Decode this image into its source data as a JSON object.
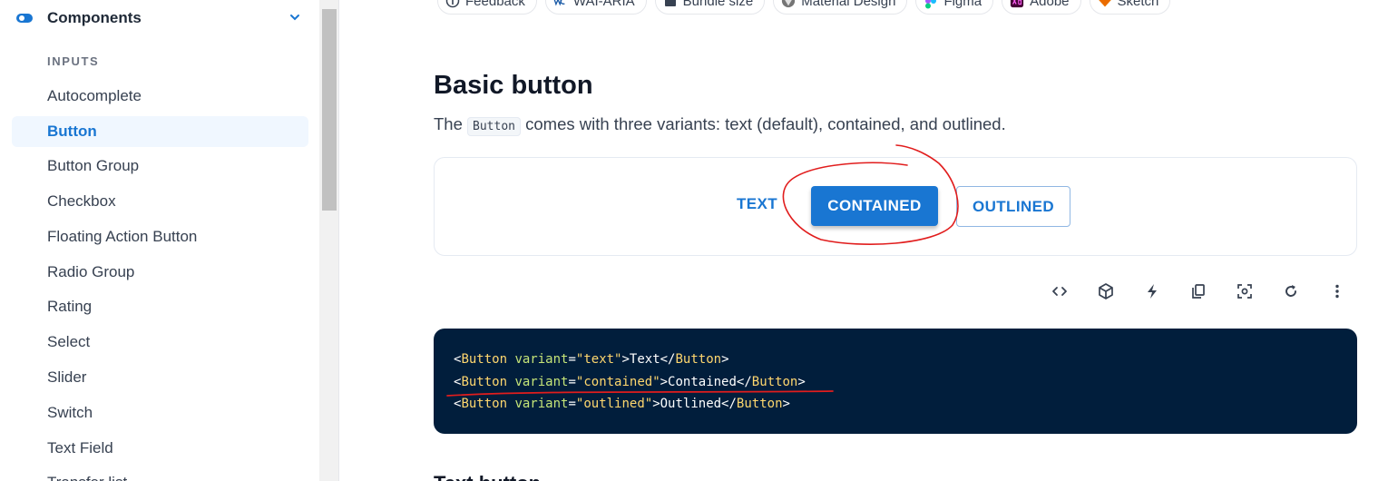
{
  "sidebar": {
    "header": "Components",
    "section": "INPUTS",
    "items": [
      {
        "label": "Autocomplete",
        "active": false
      },
      {
        "label": "Button",
        "active": true
      },
      {
        "label": "Button Group",
        "active": false
      },
      {
        "label": "Checkbox",
        "active": false
      },
      {
        "label": "Floating Action Button",
        "active": false
      },
      {
        "label": "Radio Group",
        "active": false
      },
      {
        "label": "Rating",
        "active": false
      },
      {
        "label": "Select",
        "active": false
      },
      {
        "label": "Slider",
        "active": false
      },
      {
        "label": "Switch",
        "active": false
      },
      {
        "label": "Text Field",
        "active": false
      },
      {
        "label": "Transfer list",
        "active": false
      }
    ]
  },
  "chips": [
    {
      "label": "Feedback",
      "icon": "info-icon"
    },
    {
      "label": "WAI-ARIA",
      "icon": "w3c-icon"
    },
    {
      "label": "Bundle size",
      "icon": "package-icon"
    },
    {
      "label": "Material Design",
      "icon": "material-icon"
    },
    {
      "label": "Figma",
      "icon": "figma-icon"
    },
    {
      "label": "Adobe",
      "icon": "adobe-xd-icon"
    },
    {
      "label": "Sketch",
      "icon": "sketch-icon"
    }
  ],
  "content": {
    "title": "Basic button",
    "desc_before": "The ",
    "desc_code": "Button",
    "desc_after": " comes with three variants: text (default), contained, and outlined.",
    "buttons": {
      "text": "TEXT",
      "contained": "CONTAINED",
      "outlined": "OUTLINED"
    },
    "next_heading": "Text button"
  },
  "code": [
    {
      "variant": "text",
      "label": "Text"
    },
    {
      "variant": "contained",
      "label": "Contained"
    },
    {
      "variant": "outlined",
      "label": "Outlined"
    }
  ],
  "code_syntax": {
    "tag": "Button",
    "attr": "variant"
  },
  "toolbar": [
    "code-icon",
    "sandbox-icon",
    "bolt-icon",
    "copy-icon",
    "screenshot-icon",
    "reset-icon",
    "more-icon"
  ],
  "colors": {
    "primary": "#1976d2",
    "code_bg": "#011e3c",
    "annotation": "#e11d1d"
  }
}
